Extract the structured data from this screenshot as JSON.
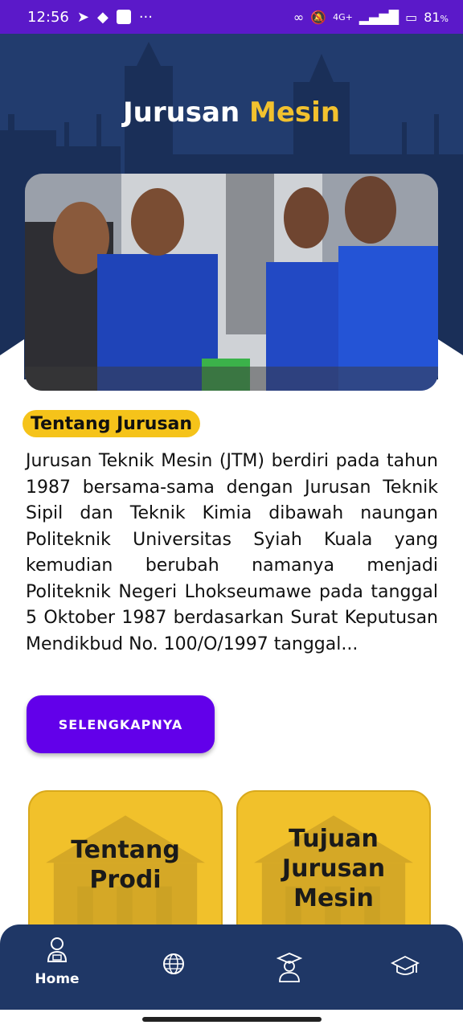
{
  "status_bar": {
    "time": "12:56",
    "dots": "···",
    "battery": "81",
    "battery_unit": "%",
    "network": "4G+"
  },
  "header": {
    "title_main": "Jurusan",
    "title_accent": "Mesin"
  },
  "about": {
    "heading": "Tentang Jurusan",
    "text": "Jurusan Teknik Mesin (JTM) berdiri pada tahun 1987 bersama-sama dengan Jurusan Teknik Sipil dan Teknik Kimia dibawah naungan Politeknik Universitas Syiah Kuala yang kemudian berubah namanya menjadi Politeknik Negeri Lhokseumawe pada tanggal 5 Oktober 1987 berdasarkan Surat Keputusan Mendikbud No. 100/O/1997 tanggal...",
    "button_label": "SELENGKAPNYA"
  },
  "cards": [
    {
      "label_line1": "Tentang",
      "label_line2": "Prodi"
    },
    {
      "label_line1": "Tujuan",
      "label_line2": "Jurusan",
      "label_line3": "Mesin"
    }
  ],
  "bottom_nav": {
    "items": [
      {
        "label": "Home",
        "icon": "student-icon"
      },
      {
        "label": "",
        "icon": "globe-icon"
      },
      {
        "label": "",
        "icon": "graduate-icon"
      },
      {
        "label": "",
        "icon": "mortarboard-icon"
      }
    ]
  },
  "colors": {
    "status_bar": "#5b19c9",
    "header_bg": "#1f3766",
    "accent": "#f2c12e",
    "badge": "#f5c31a",
    "button": "#6200ea",
    "card": "#f1c12b"
  }
}
